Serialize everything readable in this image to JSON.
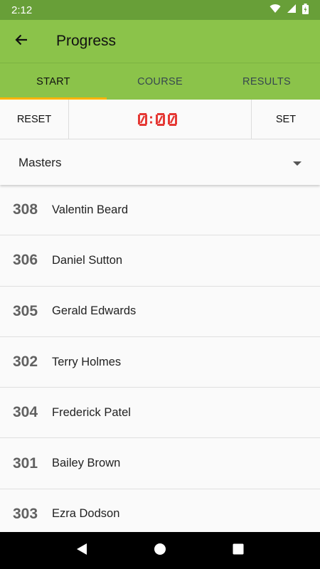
{
  "status_bar": {
    "time": "2:12"
  },
  "app_bar": {
    "title": "Progress"
  },
  "tabs": [
    {
      "label": "START",
      "active": true
    },
    {
      "label": "COURSE",
      "active": false
    },
    {
      "label": "RESULTS",
      "active": false
    }
  ],
  "timer": {
    "reset_label": "RESET",
    "display": "0:00",
    "set_label": "SET",
    "display_color": "#e53935"
  },
  "category": {
    "selected": "Masters"
  },
  "participants": [
    {
      "bib": "308",
      "name": "Valentin Beard"
    },
    {
      "bib": "306",
      "name": "Daniel Sutton"
    },
    {
      "bib": "305",
      "name": "Gerald Edwards"
    },
    {
      "bib": "302",
      "name": "Terry Holmes"
    },
    {
      "bib": "304",
      "name": "Frederick Patel"
    },
    {
      "bib": "301",
      "name": "Bailey Brown"
    },
    {
      "bib": "303",
      "name": "Ezra Dodson"
    }
  ],
  "colors": {
    "primary": "#8bc34a",
    "primary_dark": "#689f38",
    "accent": "#ffb300"
  },
  "icons": {
    "back": "arrow-back-icon",
    "dropdown": "dropdown-arrow-icon",
    "wifi": "wifi-icon",
    "signal": "signal-icon",
    "battery": "battery-icon"
  }
}
